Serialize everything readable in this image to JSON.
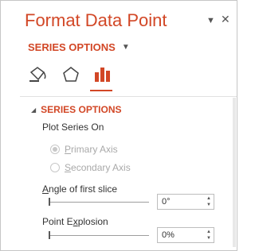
{
  "pane": {
    "title": "Format Data Point",
    "series_options_dropdown": "SERIES OPTIONS",
    "colors": {
      "accent": "#d24726"
    }
  },
  "tabs": {
    "fill_line": "fill-line-icon",
    "effects": "effects-icon",
    "series_options": "series-options-icon",
    "selected": "series_options"
  },
  "section": {
    "title": "SERIES OPTIONS",
    "plot_series_on_label": "Plot Series On",
    "primary_axis": {
      "pre": "",
      "accel": "P",
      "post": "rimary Axis",
      "selected": true,
      "enabled": false
    },
    "secondary_axis": {
      "pre": "",
      "accel": "S",
      "post": "econdary Axis",
      "selected": false,
      "enabled": false
    },
    "angle": {
      "pre": "",
      "accel": "A",
      "post": "ngle of first slice",
      "value": "0°",
      "level": 0
    },
    "explosion": {
      "pre": "Point E",
      "accel": "x",
      "post": "plosion",
      "value": "0%",
      "level": 0
    }
  }
}
